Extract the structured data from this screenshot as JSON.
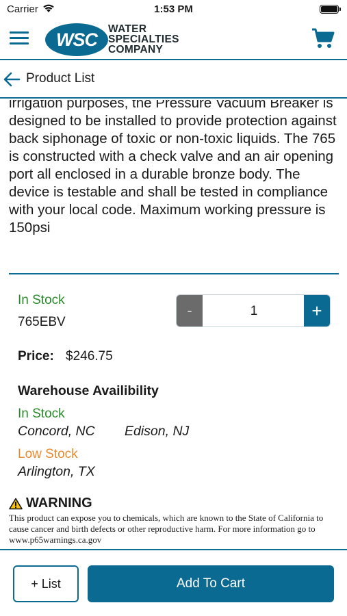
{
  "status_bar": {
    "carrier": "Carrier",
    "time": "1:53 PM"
  },
  "header": {
    "logo_abbr": "WSC",
    "logo_words": [
      "WATER",
      "SPECIALTIES",
      "COMPANY"
    ],
    "brand_color": "#0b6a92"
  },
  "nav": {
    "back_label": "Product List"
  },
  "product": {
    "description": "irrigation purposes, the Pressure Vacuum Breaker is designed to be installed to provide protection against back siphonage of toxic or non-toxic liquids. The 765 is constructed with a check valve and an air opening port all enclosed in a durable bronze body. The device is testable and shall be tested in compliance with your local code. Maximum working pressure is 150psi",
    "stock_status": "In Stock",
    "sku": "765EBV",
    "price_label": "Price:",
    "price": "$246.75"
  },
  "quantity": {
    "minus": "-",
    "value": "1",
    "plus": "+"
  },
  "warehouse": {
    "title": "Warehouse Availibility",
    "in_stock_label": "In Stock",
    "in_stock_locations": [
      "Concord, NC",
      "Edison, NJ"
    ],
    "low_stock_label": "Low Stock",
    "low_stock_locations": [
      "Arlington, TX"
    ],
    "in_stock_color": "#2a8a2a",
    "low_stock_color": "#e88a2e"
  },
  "warning": {
    "title": "WARNING",
    "text": "This product can expose you to chemicals, which are known to the State of California to cause cancer and birth defects or other reproductive harm. For more information go to www.p65warnings.ca.gov"
  },
  "footer": {
    "list_button": "+ List",
    "cart_button": "Add To Cart"
  }
}
